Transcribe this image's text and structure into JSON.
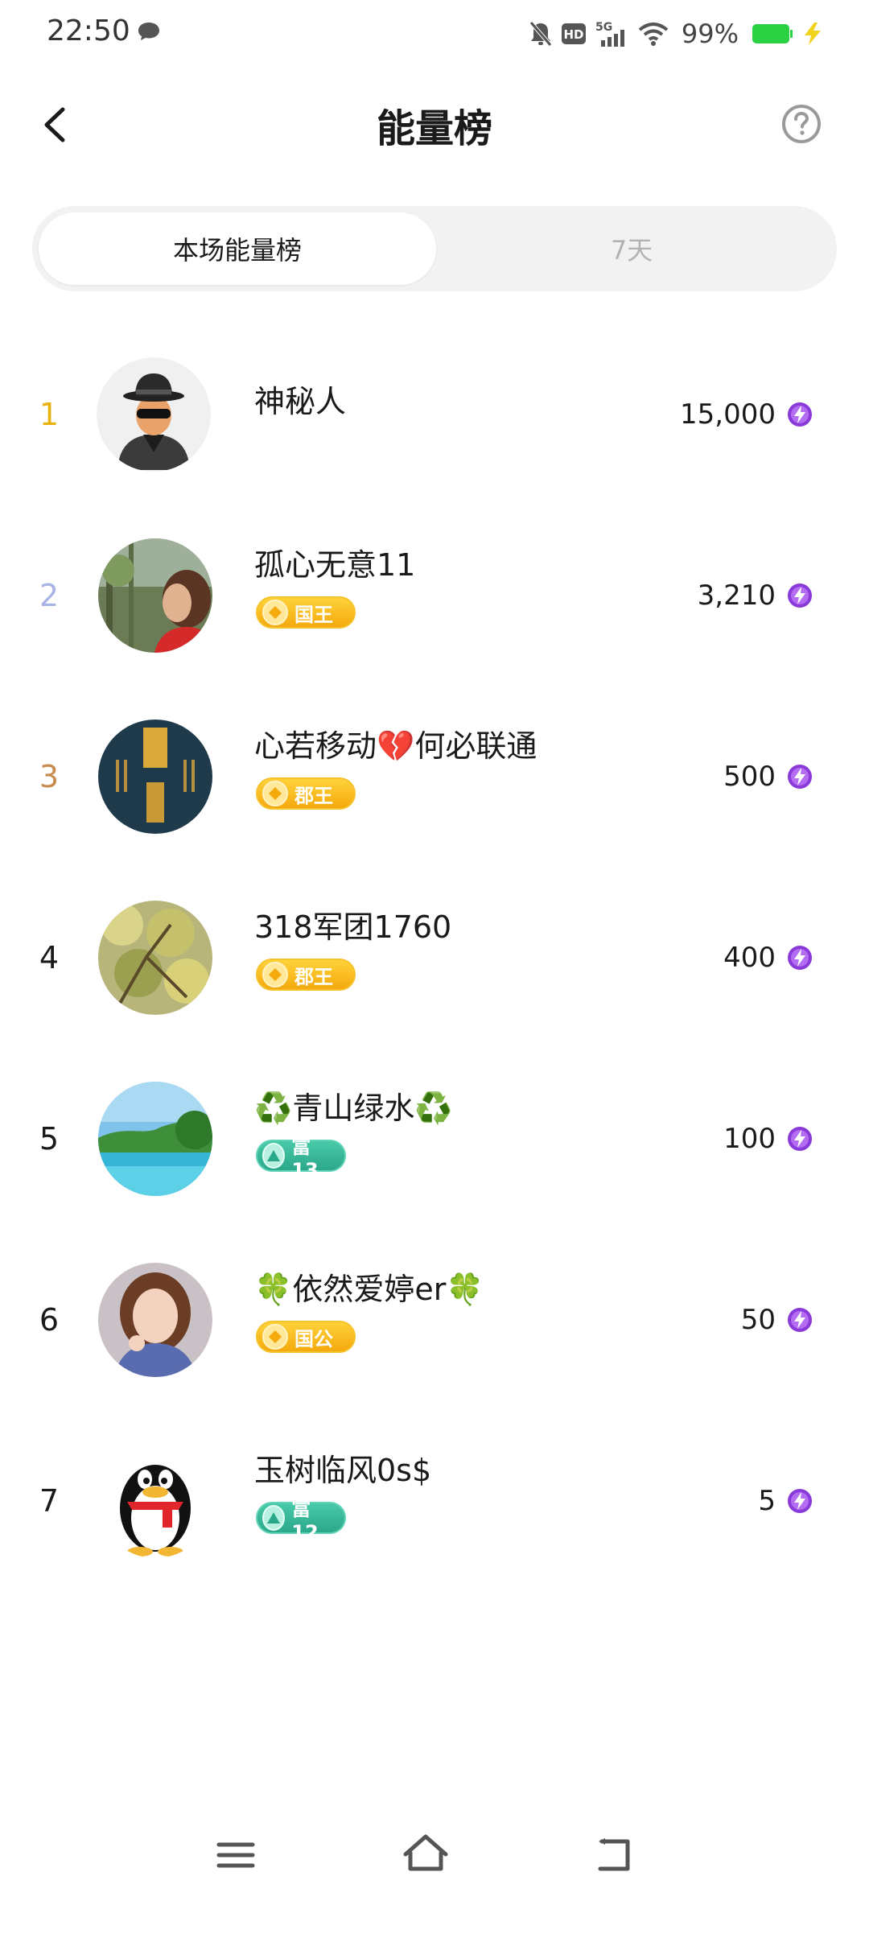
{
  "status_bar": {
    "time": "22:50",
    "battery": "99%",
    "icons": [
      "chat-bubble-icon",
      "mute-bell-icon",
      "hd-icon",
      "5g-signal-icon",
      "wifi-icon",
      "battery-icon",
      "charging-icon"
    ],
    "battery_color": "#2bd142"
  },
  "header": {
    "title": "能量榜",
    "back_icon": "chevron-left-icon",
    "help_icon": "question-circle-icon"
  },
  "tabs": [
    {
      "label": "本场能量榜",
      "active": true
    },
    {
      "label": "7天",
      "active": false
    }
  ],
  "leaderboard": [
    {
      "rank": "1",
      "rank_color": "#e8b30e",
      "name": "神秘人",
      "badge": null,
      "score": "15,000"
    },
    {
      "rank": "2",
      "rank_color": "#a9b4e6",
      "name": "孤心无意11",
      "badge": {
        "label": "国王",
        "style": "gold"
      },
      "score": "3,210"
    },
    {
      "rank": "3",
      "rank_color": "#c98a4e",
      "name": "心若移动💔何必联通",
      "badge": {
        "label": "郡王",
        "style": "gold"
      },
      "score": "500"
    },
    {
      "rank": "4",
      "rank_color": "#1a1a1a",
      "name": "318军团1760",
      "badge": {
        "label": "郡王",
        "style": "gold"
      },
      "score": "400"
    },
    {
      "rank": "5",
      "rank_color": "#1a1a1a",
      "name": "♻️青山绿水♻️",
      "badge": {
        "label": "富13",
        "style": "teal"
      },
      "score": "100"
    },
    {
      "rank": "6",
      "rank_color": "#1a1a1a",
      "name": "🍀依然爱婷er🍀",
      "badge": {
        "label": "国公",
        "style": "gold"
      },
      "score": "50"
    },
    {
      "rank": "7",
      "rank_color": "#1a1a1a",
      "name": "玉树临风0s$",
      "badge": {
        "label": "富12",
        "style": "teal"
      },
      "score": "5"
    }
  ],
  "energy_icon": "purple-lightning-icon",
  "accent_colors": {
    "energy": "#8a3ad8",
    "gold_badge": "#f4a90d",
    "teal_badge": "#2ba88a"
  },
  "nav_bar": {
    "items": [
      "menu-icon",
      "home-icon",
      "back-icon"
    ]
  }
}
